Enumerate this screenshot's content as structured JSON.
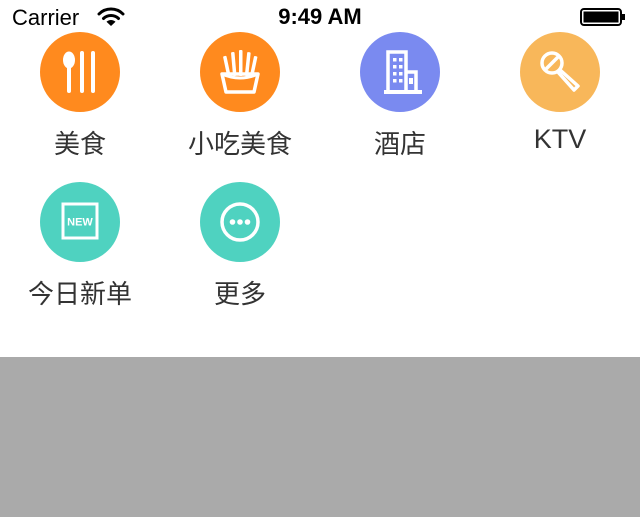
{
  "status_bar": {
    "carrier": "Carrier",
    "time": "9:49 AM"
  },
  "categories": [
    {
      "label": "美食",
      "icon": "fork-spoon-icon",
      "color": "#FF8A1E"
    },
    {
      "label": "小吃美食",
      "icon": "fries-icon",
      "color": "#FF8A1E"
    },
    {
      "label": "酒店",
      "icon": "hotel-building-icon",
      "color": "#7A8AF0"
    },
    {
      "label": "KTV",
      "icon": "microphone-icon",
      "color": "#F8B75A"
    },
    {
      "label": "今日新单",
      "icon": "new-badge-icon",
      "color": "#4FD2C0",
      "badge_text": "NEW"
    },
    {
      "label": "更多",
      "icon": "more-dots-icon",
      "color": "#4FD2C0"
    }
  ],
  "colors": {
    "gray_area": "#AAAAAA"
  }
}
